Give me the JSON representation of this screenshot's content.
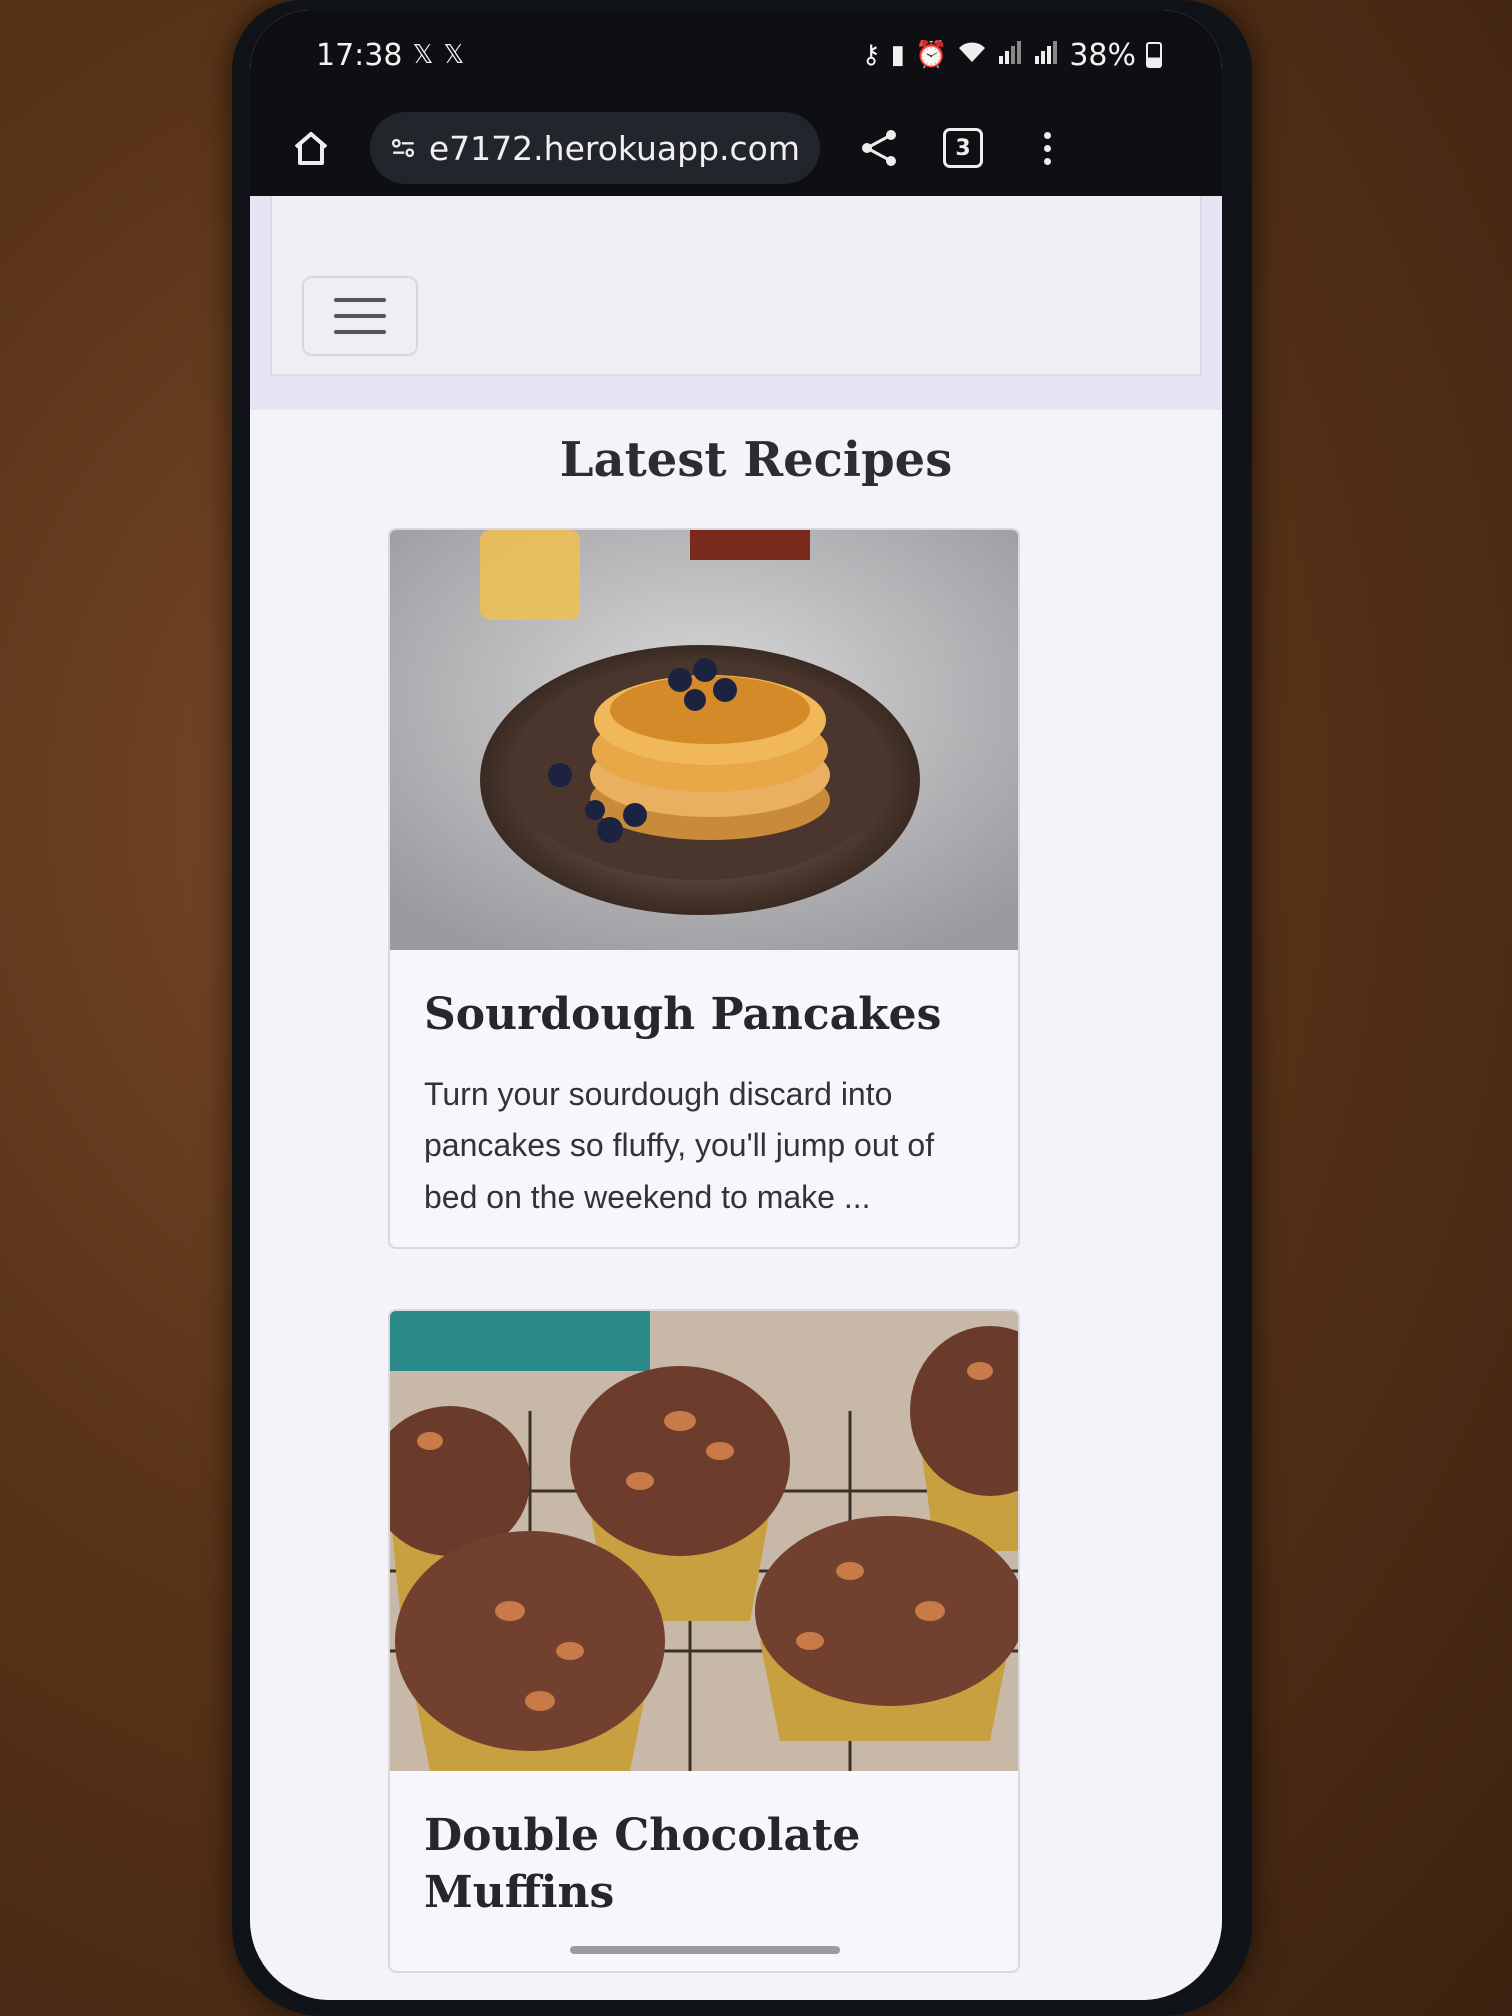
{
  "status_bar": {
    "time": "17:38",
    "left_icons": [
      "x-app-icon",
      "x-app-icon"
    ],
    "right_icons": [
      "key-icon",
      "battery-saver-icon",
      "alarm-icon",
      "wifi-icon",
      "signal-icon",
      "signal-icon"
    ],
    "battery": "38%"
  },
  "browser": {
    "url": "e7172.herokuapp.com",
    "tab_count": "3"
  },
  "page": {
    "section_title": "Latest Recipes",
    "recipes": [
      {
        "title": "Sourdough Pancakes",
        "excerpt": "Turn your sourdough discard into pancakes so fluffy, you'll jump out of bed on the weekend to make ..."
      },
      {
        "title": "Double Chocolate Muffins",
        "excerpt": ""
      }
    ]
  },
  "colors": {
    "navbar_bg": "#efeef2",
    "accent_band": "#e8e4f4",
    "text_dark": "#2c2c35"
  }
}
